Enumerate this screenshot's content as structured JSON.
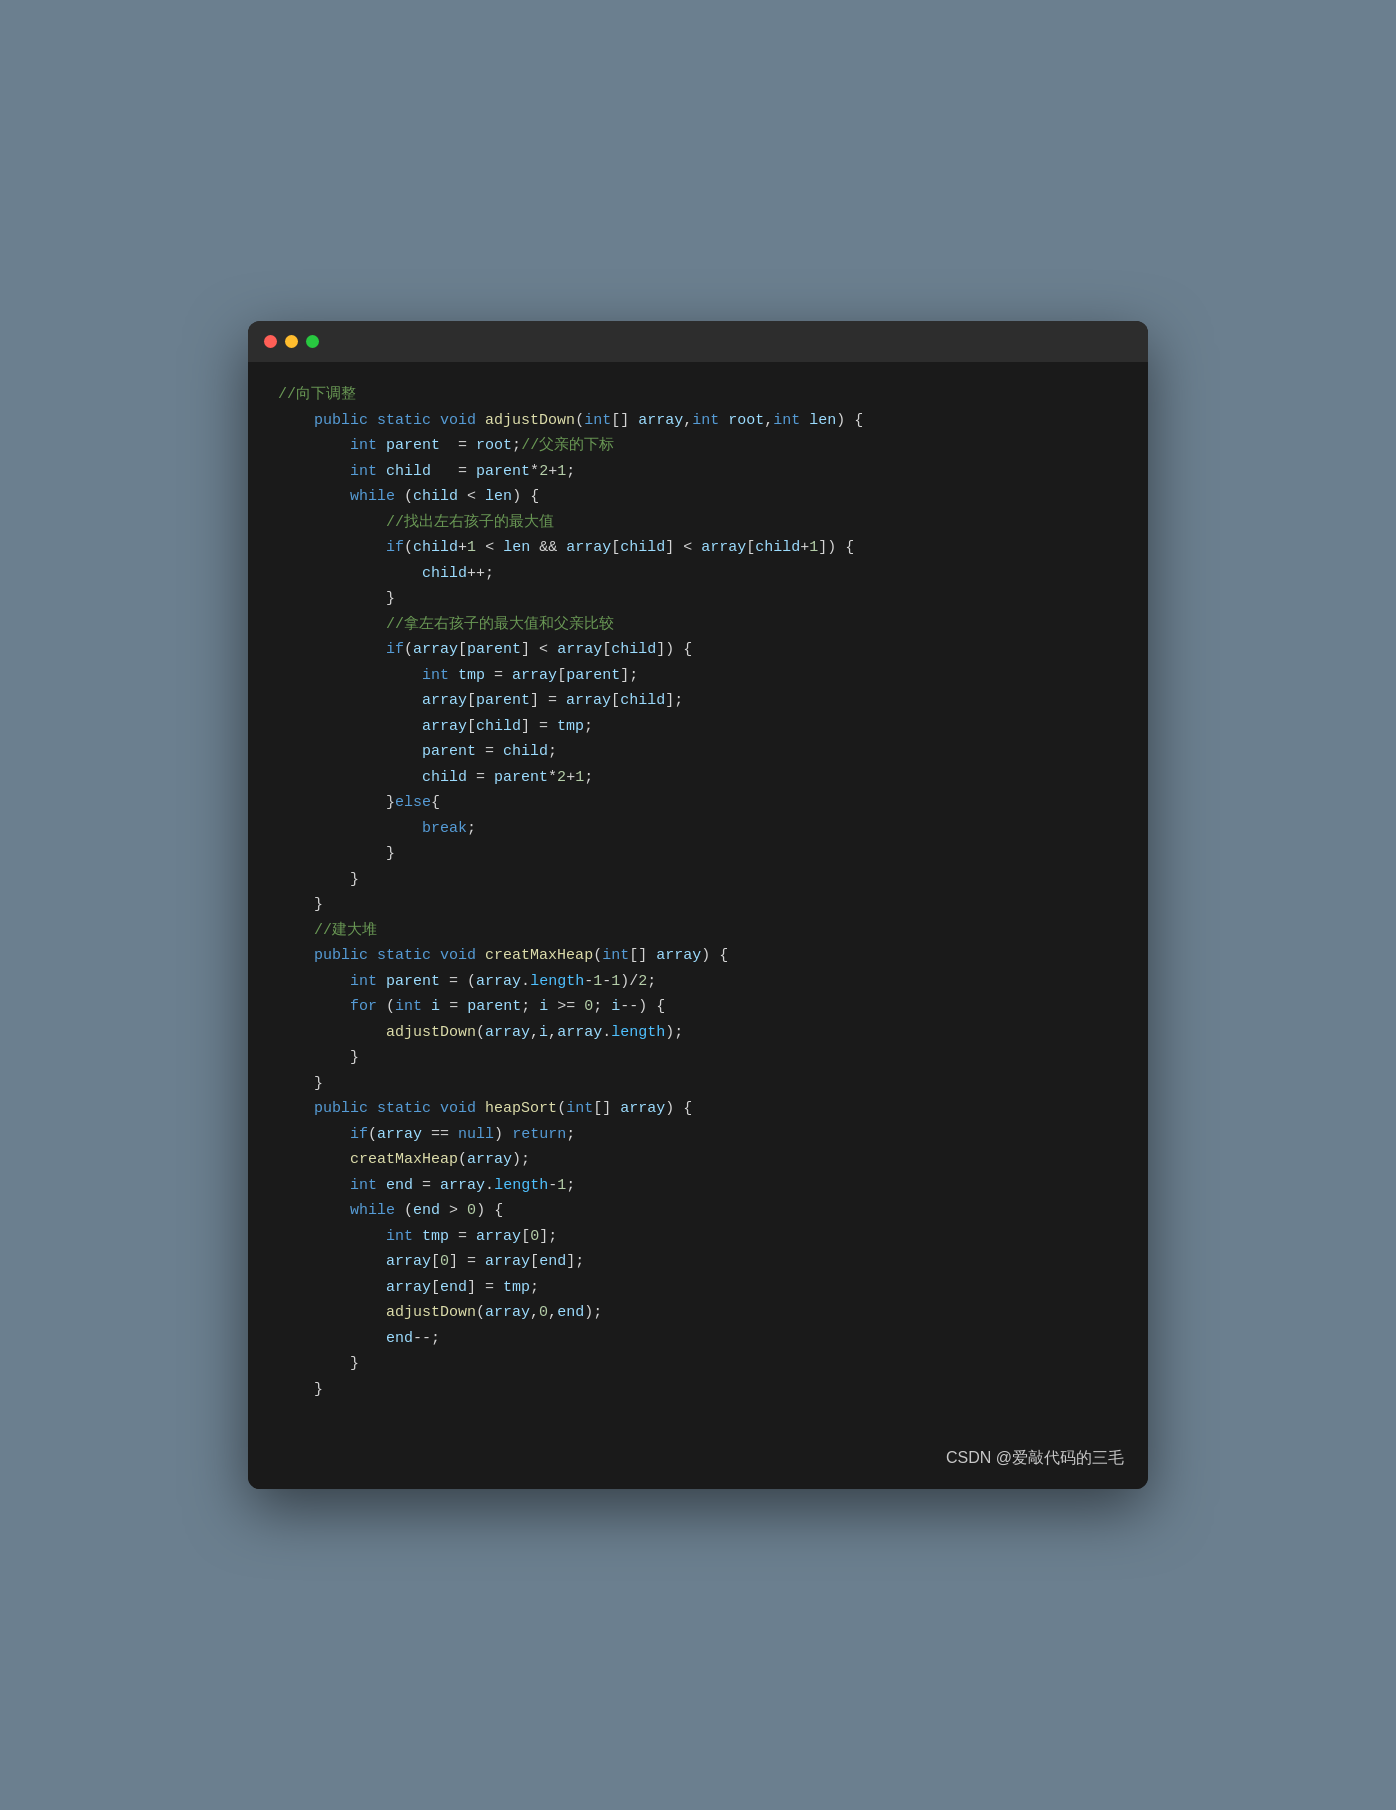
{
  "window": {
    "dots": [
      "red",
      "yellow",
      "green"
    ]
  },
  "code": {
    "lines": [
      {
        "id": "l1",
        "content": "//向下调整"
      },
      {
        "id": "l2",
        "content": "    public static void adjustDown(int[] array,int root,int len) {"
      },
      {
        "id": "l3",
        "content": "        int parent  = root;//父亲的下标"
      },
      {
        "id": "l4",
        "content": "        int child   = parent*2+1;"
      },
      {
        "id": "l5",
        "content": "        while (child < len) {"
      },
      {
        "id": "l6",
        "content": "            //找出左右孩子的最大值"
      },
      {
        "id": "l7",
        "content": "            if(child+1 < len && array[child] < array[child+1]) {"
      },
      {
        "id": "l8",
        "content": "                child++;"
      },
      {
        "id": "l9",
        "content": "            }"
      },
      {
        "id": "l10",
        "content": "            //拿左右孩子的最大值和父亲比较"
      },
      {
        "id": "l11",
        "content": "            if(array[parent] < array[child]) {"
      },
      {
        "id": "l12",
        "content": "                int tmp = array[parent];"
      },
      {
        "id": "l13",
        "content": "                array[parent] = array[child];"
      },
      {
        "id": "l14",
        "content": "                array[child] = tmp;"
      },
      {
        "id": "l15",
        "content": "                parent = child;"
      },
      {
        "id": "l16",
        "content": "                child = parent*2+1;"
      },
      {
        "id": "l17",
        "content": "            }else{"
      },
      {
        "id": "l18",
        "content": "                break;"
      },
      {
        "id": "l19",
        "content": "            }"
      },
      {
        "id": "l20",
        "content": "        }"
      },
      {
        "id": "l21",
        "content": "    }"
      },
      {
        "id": "l22",
        "content": "    //建大堆"
      },
      {
        "id": "l23",
        "content": "    public static void creatMaxHeap(int[] array) {"
      },
      {
        "id": "l24",
        "content": "        int parent = (array.length-1-1)/2;"
      },
      {
        "id": "l25",
        "content": "        for (int i = parent; i >= 0; i--) {"
      },
      {
        "id": "l26",
        "content": "            adjustDown(array,i,array.length);"
      },
      {
        "id": "l27",
        "content": "        }"
      },
      {
        "id": "l28",
        "content": "    }"
      },
      {
        "id": "l29",
        "content": "    public static void heapSort(int[] array) {"
      },
      {
        "id": "l30",
        "content": "        if(array == null) return;"
      },
      {
        "id": "l31",
        "content": "        creatMaxHeap(array);"
      },
      {
        "id": "l32",
        "content": "        int end = array.length-1;"
      },
      {
        "id": "l33",
        "content": "        while (end > 0) {"
      },
      {
        "id": "l34",
        "content": "            int tmp = array[0];"
      },
      {
        "id": "l35",
        "content": "            array[0] = array[end];"
      },
      {
        "id": "l36",
        "content": "            array[end] = tmp;"
      },
      {
        "id": "l37",
        "content": "            adjustDown(array,0,end);"
      },
      {
        "id": "l38",
        "content": "            end--;"
      },
      {
        "id": "l39",
        "content": "        }"
      },
      {
        "id": "l40",
        "content": "    }"
      }
    ]
  },
  "watermark": {
    "text": "CSDN @爱敲代码的三毛"
  }
}
